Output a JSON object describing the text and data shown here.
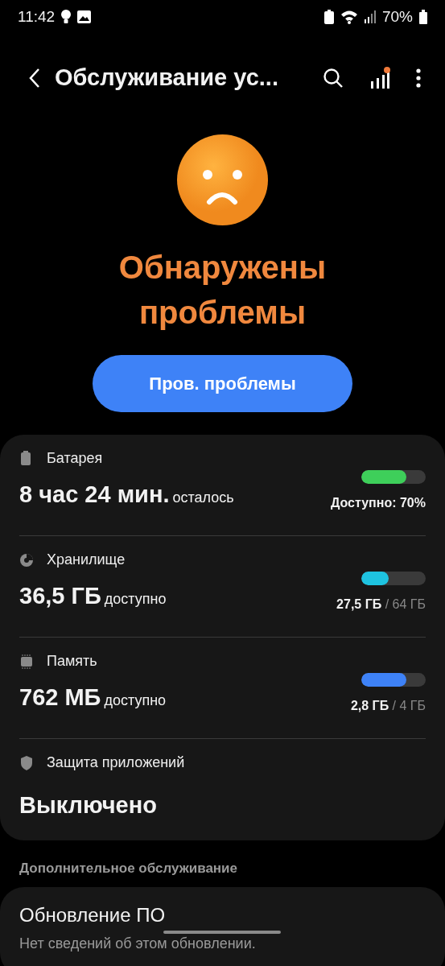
{
  "status_bar": {
    "time": "11:42",
    "battery": "70%"
  },
  "header": {
    "title": "Обслуживание ус..."
  },
  "result": {
    "title": "Обнаружены проблемы",
    "button": "Пров. проблемы"
  },
  "items": [
    {
      "kind": "meter",
      "label": "Батарея",
      "value": "8 час 24 мин.",
      "suffix": "осталось",
      "level": 0.7,
      "color": "#3ecf5a",
      "reading": "Доступно: 70%"
    },
    {
      "kind": "meter",
      "label": "Хранилище",
      "value": "36,5 ГБ",
      "suffix": "доступно",
      "level": 0.43,
      "color": "#1ec3e0",
      "reading": "27,5 ГБ",
      "total": "/ 64 ГБ"
    },
    {
      "kind": "meter",
      "label": "Память",
      "value": "762 МБ",
      "suffix": "доступно",
      "level": 0.7,
      "color": "#3e82f7",
      "reading": "2,8 ГБ",
      "total": "/ 4 ГБ"
    },
    {
      "kind": "status",
      "label": "Защита приложений",
      "value": "Выключено"
    }
  ],
  "extra": {
    "heading": "Дополнительное обслуживание",
    "items": [
      {
        "title": "Обновление ПО",
        "subtitle": "Нет сведений об этом обновлении."
      }
    ]
  }
}
